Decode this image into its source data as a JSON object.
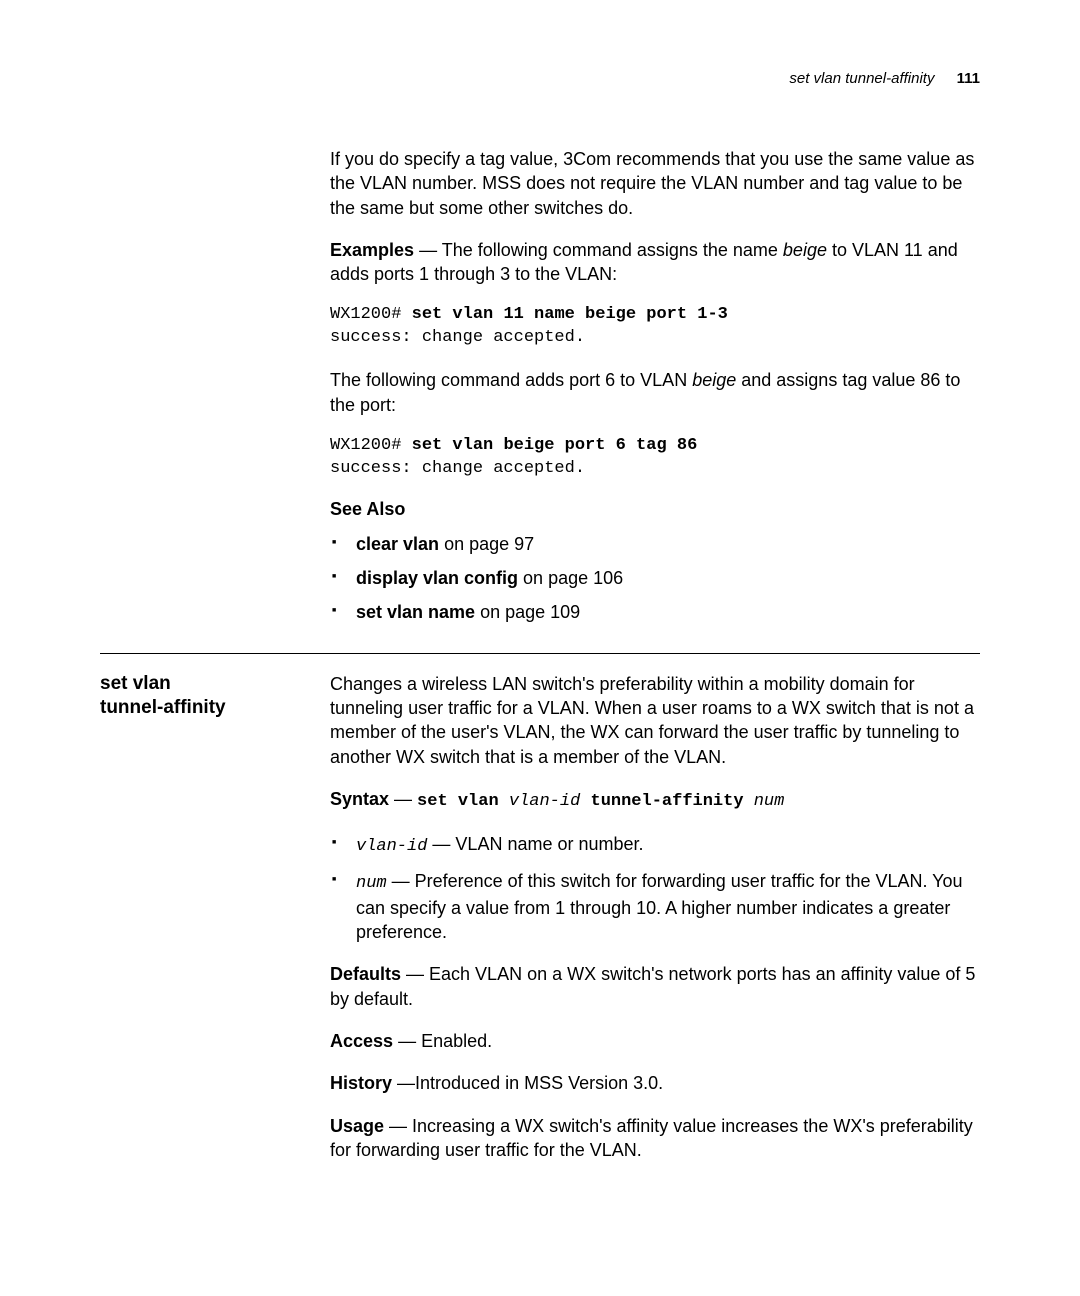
{
  "header": {
    "title": "set vlan tunnel-affinity",
    "page_number": "111"
  },
  "top": {
    "para1": "If you do specify a tag value, 3Com recommends that you use the same value as the VLAN number. MSS does not require the VLAN number and tag value to be the same but some other switches do.",
    "examples_label": "Examples",
    "examples_intro_a": " — The following command assigns the name ",
    "examples_name": "beige",
    "examples_intro_b": " to VLAN 11 and adds ports 1 through 3 to the VLAN:",
    "code1_prompt": "WX1200# ",
    "code1_cmd": "set vlan 11 name beige port 1-3",
    "code1_out": "success: change accepted.",
    "para2_a": "The following command adds port 6 to VLAN ",
    "para2_name": "beige",
    "para2_b": " and assigns tag value 86 to the port:",
    "code2_prompt": "WX1200# ",
    "code2_cmd": "set vlan beige port 6 tag 86",
    "code2_out": "success: change accepted.",
    "see_also_label": "See Also",
    "see_also_items": [
      {
        "cmd": "clear vlan",
        "rest": " on page 97"
      },
      {
        "cmd": "display vlan config",
        "rest": " on page 106"
      },
      {
        "cmd": "set vlan name",
        "rest": " on page 109"
      }
    ]
  },
  "section": {
    "sidebar_line1": "set vlan",
    "sidebar_line2": "tunnel-affinity",
    "desc": "Changes a wireless LAN switch's preferability within a mobility domain for tunneling user traffic for a VLAN. When a user roams to a WX switch that is not a member of the user's VLAN, the WX can forward the user traffic by tunneling to another WX switch that is a member of the VLAN.",
    "syntax_label": "Syntax",
    "syntax_dash": " — ",
    "syntax_cmd1": "set vlan ",
    "syntax_arg1": "vlan-id",
    "syntax_cmd2": " tunnel-affinity ",
    "syntax_arg2": "num",
    "params": [
      {
        "name": "vlan-id",
        "desc": " — VLAN name or number."
      },
      {
        "name": "num",
        "desc": " — Preference of this switch for forwarding user traffic for the VLAN. You can specify a value from 1 through 10. A higher number indicates a greater preference."
      }
    ],
    "defaults_label": "Defaults",
    "defaults_text": " — Each VLAN on a WX switch's network ports has an affinity value of 5 by default.",
    "access_label": "Access",
    "access_text": " — Enabled.",
    "history_label": "History",
    "history_text": " —Introduced in MSS Version 3.0.",
    "usage_label": "Usage",
    "usage_text": " — Increasing a WX switch's affinity value increases the WX's preferability for forwarding user traffic for the VLAN."
  }
}
